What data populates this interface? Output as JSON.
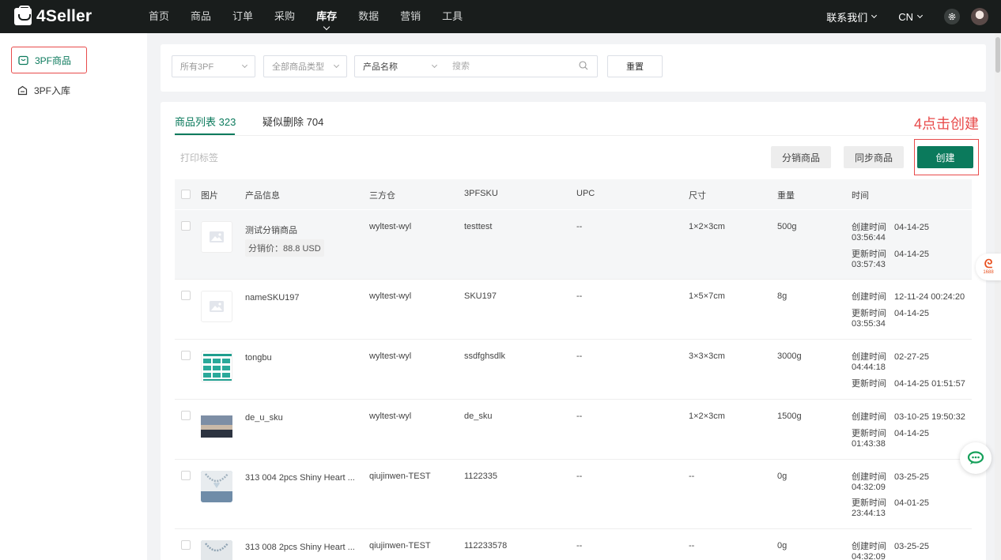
{
  "header": {
    "logo": "4Seller",
    "nav": [
      "首页",
      "商品",
      "订单",
      "采购",
      "库存",
      "数据",
      "营销",
      "工具"
    ],
    "nav_active": "库存",
    "contact": "联系我们",
    "language": "CN"
  },
  "sidebar": {
    "items": [
      {
        "label": "3PF商品",
        "icon": "product-icon",
        "active": true
      },
      {
        "label": "3PF入库",
        "icon": "inbound-icon",
        "active": false
      }
    ]
  },
  "filters": {
    "warehouse": "所有3PF",
    "product_type": "全部商品类型",
    "search_field": "产品名称",
    "search_placeholder": "搜索",
    "reset": "重置"
  },
  "tabs": [
    {
      "label": "商品列表 323",
      "active": true
    },
    {
      "label": "疑似删除 704",
      "active": false
    }
  ],
  "annotation": "4点击创建",
  "toolbar": {
    "print_label": "打印标签",
    "distribute": "分销商品",
    "sync": "同步商品",
    "create": "创建"
  },
  "table": {
    "columns": [
      "图片",
      "产品信息",
      "三方仓",
      "3PFSKU",
      "UPC",
      "尺寸",
      "重量",
      "时间"
    ],
    "created_label": "创建时间",
    "updated_label": "更新时间",
    "rows": [
      {
        "name": "测试分销商品",
        "price": "分销价：88.8 USD",
        "warehouse": "wyltest-wyl",
        "sku": "testtest",
        "upc": "--",
        "size": "1×2×3cm",
        "weight": "500g",
        "created": [
          "04-14-25",
          "03:56:44"
        ],
        "updated": [
          "04-14-25",
          "03:57:43"
        ],
        "image": "placeholder",
        "highlight": true
      },
      {
        "name": "nameSKU197",
        "warehouse": "wyltest-wyl",
        "sku": "SKU197",
        "upc": "--",
        "size": "1×5×7cm",
        "weight": "8g",
        "created": [
          "12-11-24 00:24:20"
        ],
        "updated": [
          "04-14-25",
          "03:55:34"
        ],
        "image": "placeholder"
      },
      {
        "name": "tongbu",
        "warehouse": "wyltest-wyl",
        "sku": "ssdfghsdlk",
        "upc": "--",
        "size": "3×3×3cm",
        "weight": "3000g",
        "created": [
          "02-27-25",
          "04:44:18"
        ],
        "updated": [
          "04-14-25 01:51:57"
        ],
        "image": "grid"
      },
      {
        "name": "de_u_sku",
        "warehouse": "wyltest-wyl",
        "sku": "de_sku",
        "upc": "--",
        "size": "1×2×3cm",
        "weight": "1500g",
        "created": [
          "03-10-25 19:50:32"
        ],
        "updated": [
          "04-14-25",
          "01:43:38"
        ],
        "image": "landscape"
      },
      {
        "name": "313 004 2pcs Shiny Heart ...",
        "warehouse": "qiujinwen-TEST",
        "sku": "1122335",
        "upc": "--",
        "size": "--",
        "weight": "0g",
        "created": [
          "03-25-25",
          "04:32:09"
        ],
        "updated": [
          "04-01-25",
          "23:44:13"
        ],
        "image": "jewelry"
      },
      {
        "name": "313 008 2pcs Shiny Heart ...",
        "warehouse": "qiujinwen-TEST",
        "sku": "112233578",
        "upc": "--",
        "size": "--",
        "weight": "0g",
        "created": [
          "03-25-25",
          "04:32:09"
        ],
        "updated": [],
        "image": "jewelry"
      }
    ]
  },
  "floating": {
    "badge_1688": "1688"
  }
}
